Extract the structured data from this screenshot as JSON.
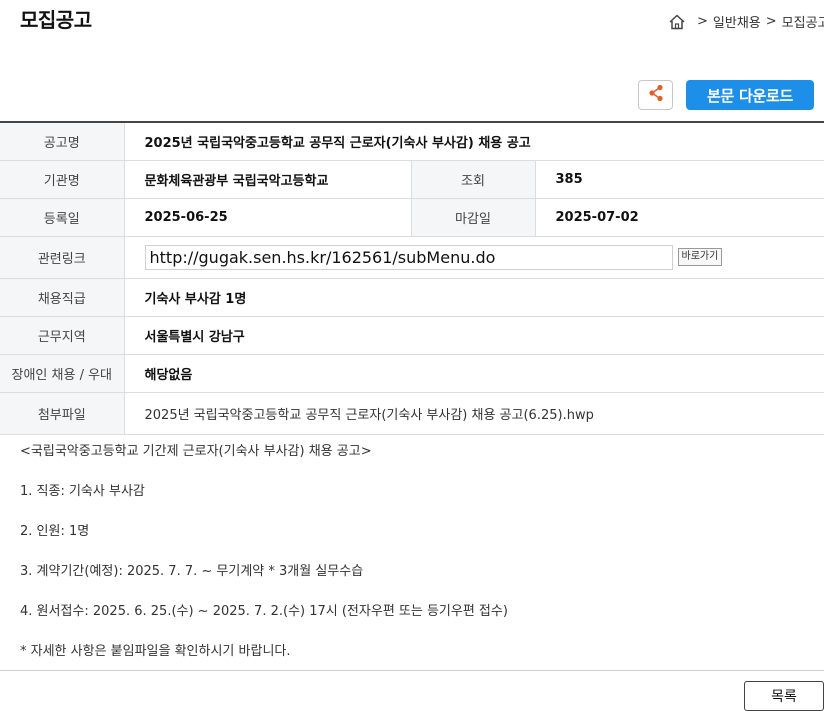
{
  "header": {
    "title": "모집공고",
    "breadcrumb": {
      "sep1": ">",
      "item1": "일반채용",
      "sep2": ">",
      "item2": "모집공고"
    }
  },
  "actions": {
    "download_label": "본문 다운로드"
  },
  "table": {
    "rows": {
      "title": {
        "label": "공고명",
        "value": "2025년 국립국악중고등학교 공무직 근로자(기숙사 부사감) 채용 공고"
      },
      "org": {
        "label": "기관명",
        "value": "문화체육관광부 국립국악고등학교",
        "label2": "조회",
        "value2": "385"
      },
      "dates": {
        "label": "등록일",
        "value": "2025-06-25",
        "label2": "마감일",
        "value2": "2025-07-02"
      },
      "link": {
        "label": "관련링크",
        "value": "http://gugak.sen.hs.kr/162561/subMenu.do",
        "button": "바로가기"
      },
      "position": {
        "label": "채용직급",
        "value": "기숙사 부사감 1명"
      },
      "region": {
        "label": "근무지역",
        "value": "서울특별시 강남구"
      },
      "disabled": {
        "label": "장애인 채용 / 우대",
        "value": "해당없음"
      },
      "attachment": {
        "label": "첨부파일",
        "value": "2025년 국립국악중고등학교 공무직 근로자(기숙사 부사감) 채용 공고(6.25).hwp"
      }
    }
  },
  "content": {
    "lines": [
      "<국립국악중고등학교 기간제 근로자(기숙사 부사감) 채용 공고>",
      "1. 직종: 기숙사 부사감",
      "2. 인원: 1명",
      "3. 계약기간(예정): 2025. 7. 7. ~ 무기계약  * 3개월 실무수습",
      "4. 원서접수: 2025. 6. 25.(수) ~ 2025. 7. 2.(수) 17시 (전자우편 또는 등기우편 접수)",
      "* 자세한 사항은 붙임파일을 확인하시기 바랍니다."
    ]
  },
  "footer": {
    "list_label": "목록"
  },
  "colors": {
    "accent": "#1e8fe8",
    "share_icon": "#e0602a",
    "header_cell_bg": "#f5f6f8"
  },
  "icons": {
    "home": "home-icon",
    "share": "share-icon"
  }
}
